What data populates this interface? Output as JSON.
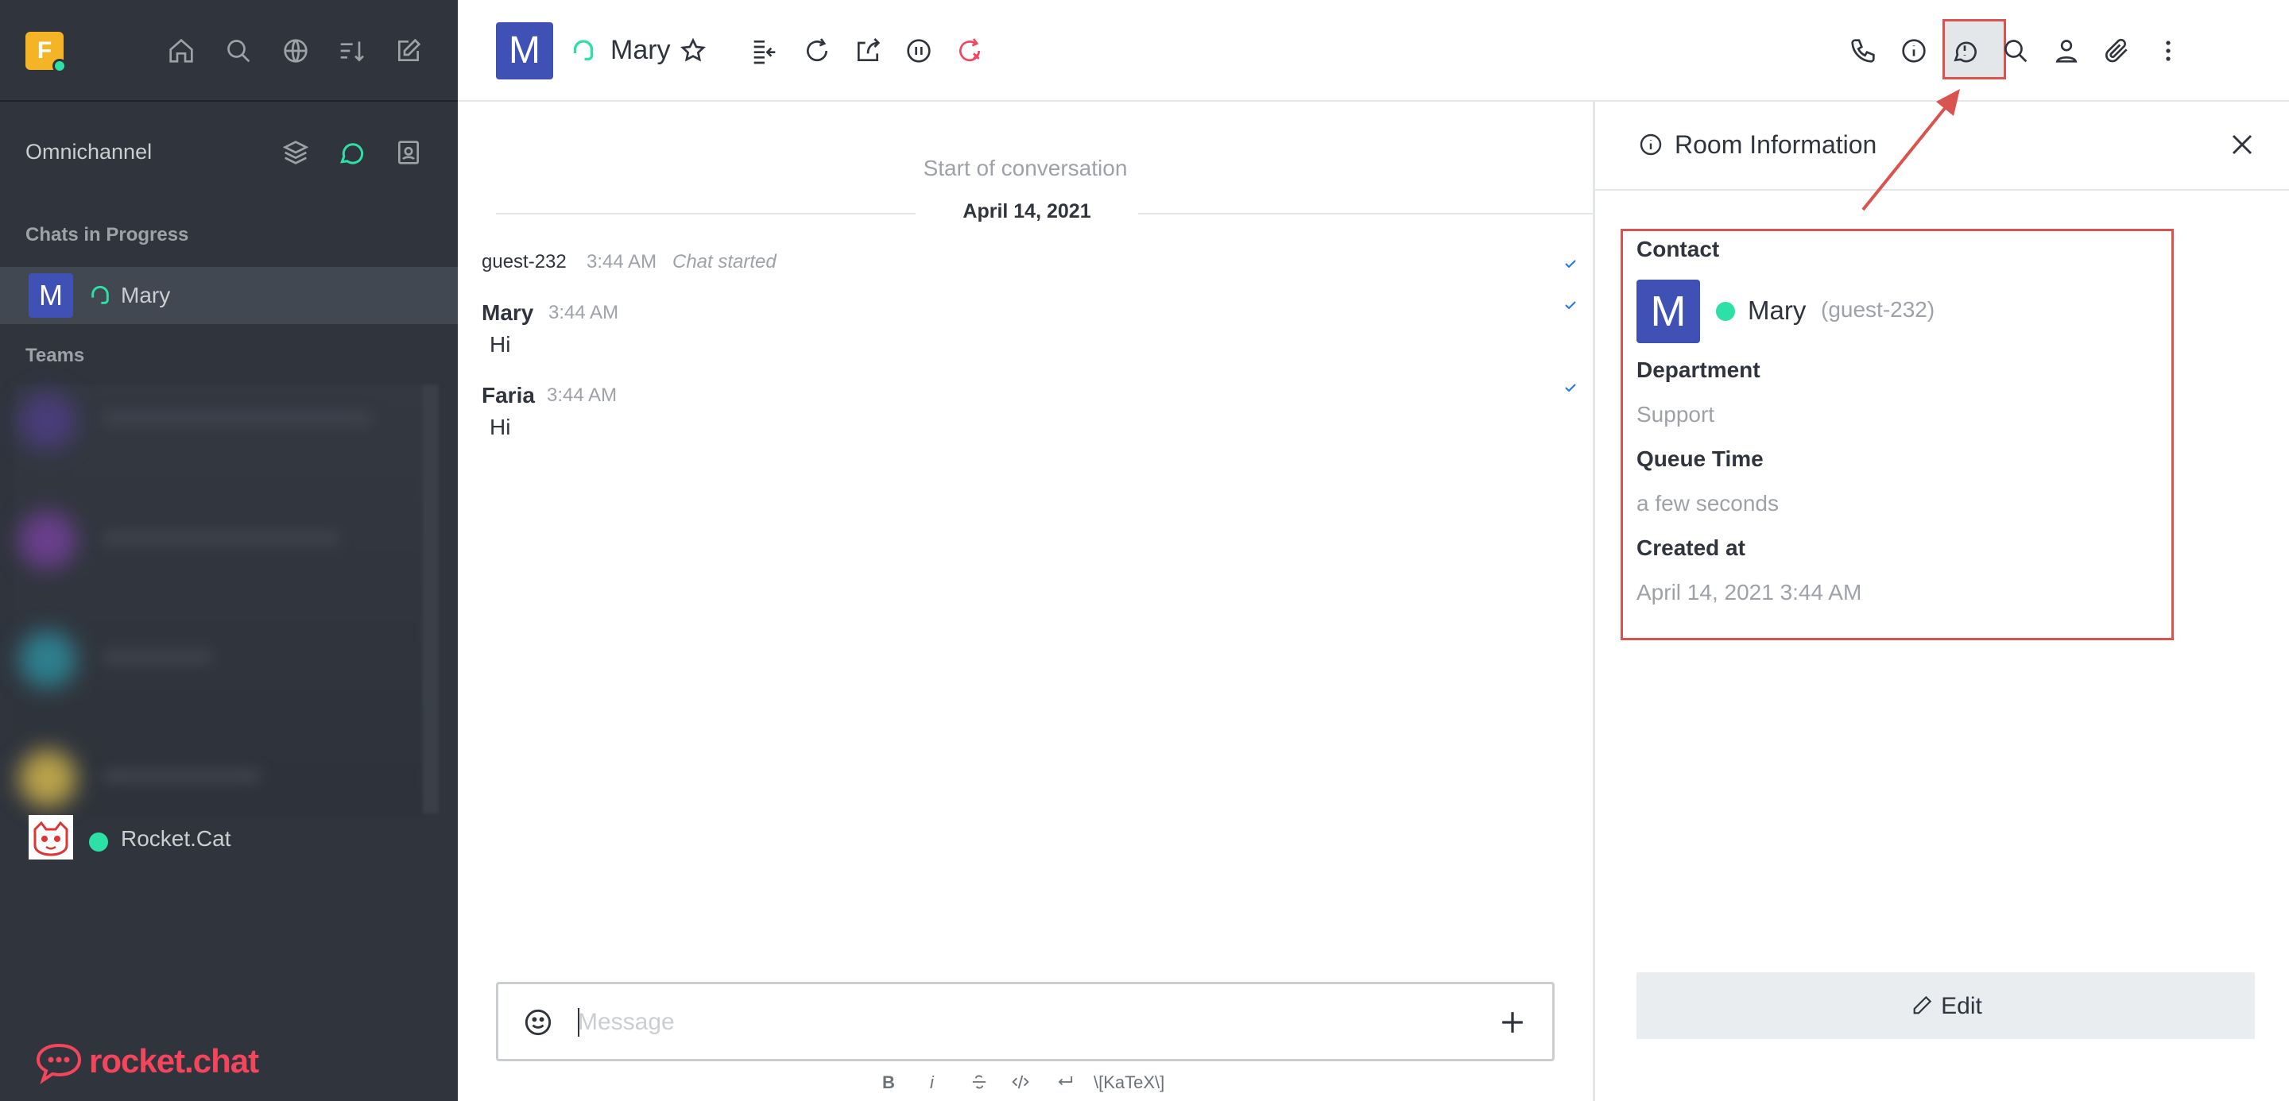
{
  "sidebar": {
    "workspace_initial": "F",
    "omnichannel_label": "Omnichannel",
    "chats_in_progress_title": "Chats in Progress",
    "chats": [
      {
        "initial": "M",
        "name": "Mary"
      }
    ],
    "teams_title": "Teams",
    "bottom_room": {
      "name": "Rocket.Cat"
    },
    "brand_text": "rocket.chat"
  },
  "header": {
    "avatar_initial": "M",
    "title": "Mary"
  },
  "messages": {
    "start_label": "Start of conversation",
    "day_label": "April 14, 2021",
    "system": {
      "user": "guest-232",
      "time": "3:44 AM",
      "text": "Chat started"
    },
    "items": [
      {
        "user": "Mary",
        "time": "3:44 AM",
        "text": "Hi"
      },
      {
        "user": "Faria",
        "time": "3:44 AM",
        "text": "Hi"
      }
    ]
  },
  "composer": {
    "placeholder": "Message",
    "format_bar": {
      "bold": "B",
      "italic": "i",
      "katex": "\\[KaTeX\\]"
    }
  },
  "room_info": {
    "title": "Room Information",
    "contact_label": "Contact",
    "contact": {
      "initial": "M",
      "name": "Mary",
      "username": "(guest-232)"
    },
    "department_label": "Department",
    "department": "Support",
    "queue_time_label": "Queue Time",
    "queue_time": "a few seconds",
    "created_at_label": "Created at",
    "created_at": "April 14, 2021 3:44 AM",
    "edit_label": "Edit"
  },
  "colors": {
    "sidebar_bg": "#2f343d",
    "accent_online": "#2de0a5",
    "avatar_blue": "#3f51b5",
    "highlight_red": "#d9534f",
    "brand_red": "#f5455c"
  }
}
